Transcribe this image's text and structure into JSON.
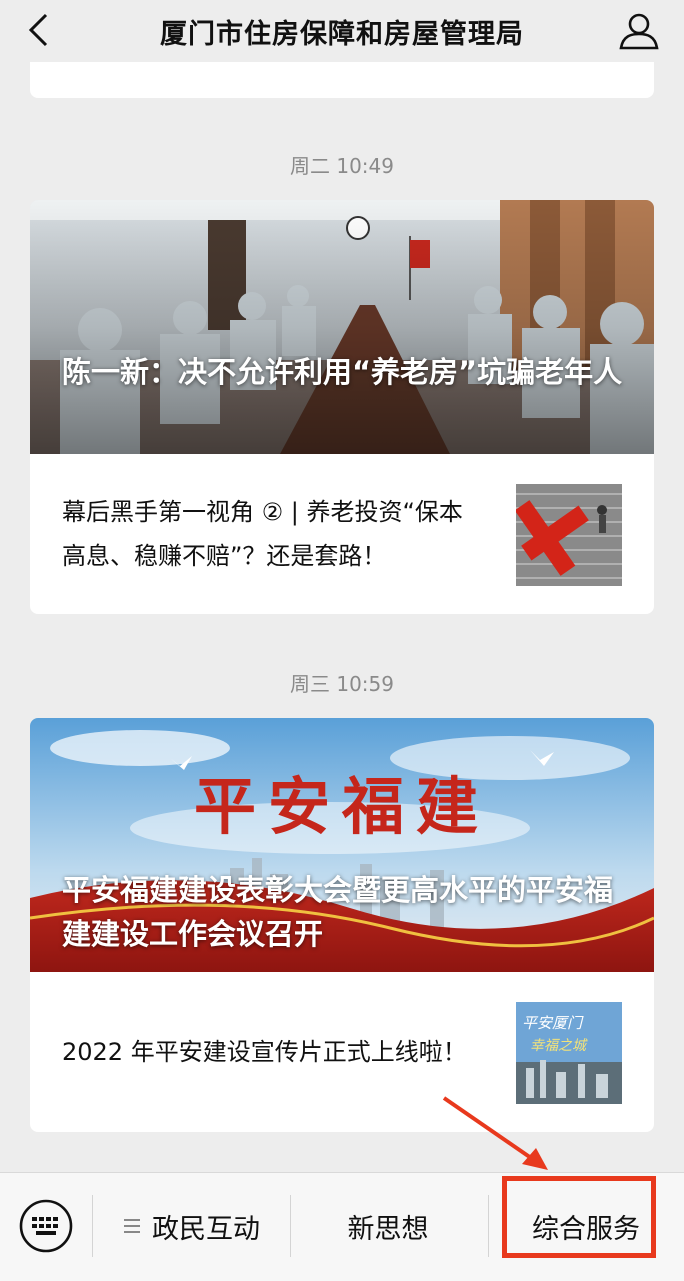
{
  "header": {
    "title": "厦门市住房保障和房屋管理局",
    "back_icon": "chevron-left-icon",
    "user_icon": "user-icon"
  },
  "messages": [
    {
      "timestamp": "周二 10:49",
      "hero_title": "陈一新：决不允许利用“养老房”坑骗老年人",
      "sub_title": "幕后黑手第一视角 ② | 养老投资“保本高息、稳赚不赔”？还是套路！"
    },
    {
      "timestamp": "周三 10:59",
      "hero_title": "平安福建建设表彰大会暨更高水平的平安福建建设工作会议召开",
      "hero_banner_text": "平安福建",
      "sub_title": "2022 年平安建设宣传片正式上线啦！",
      "thumb_text": "平安厦门 幸福之城"
    }
  ],
  "menu": {
    "keyboard_icon": "keyboard-icon",
    "items": [
      {
        "label": "政民互动",
        "icon": "menu-lines-icon"
      },
      {
        "label": "新思想"
      },
      {
        "label": "综合服务"
      }
    ]
  },
  "colors": {
    "background": "#ededed",
    "highlight": "#e8391d"
  }
}
